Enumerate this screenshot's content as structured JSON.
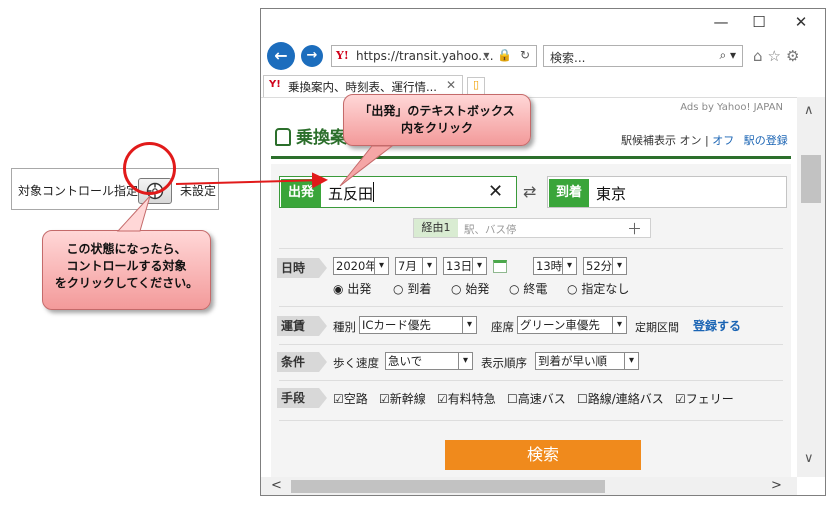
{
  "panel": {
    "label": "対象コントロール指定",
    "status": "未設定"
  },
  "callout_left": {
    "line1": "この状態になったら、",
    "line2": "コントロールする対象",
    "line3": "をクリックしてください。"
  },
  "callout_top": {
    "line1": "「出発」のテキストボックス",
    "line2": "内をクリック"
  },
  "browser": {
    "window_controls": {
      "minimize": "—",
      "maximize": "☐",
      "close": "✕"
    },
    "address": "https://transit.yahoo....",
    "address_tools": "▾ 🔒 ↻",
    "search_placeholder": "検索...",
    "tab_title": "乗換案内、時刻表、運行情...",
    "logo_text": "Y!"
  },
  "page": {
    "ads": "Ads by Yahoo! JAPAN",
    "site_title": "乗換案",
    "header": {
      "station_suggest": "駅候補表示",
      "on": "オン",
      "divider": "|",
      "off": "オフ",
      "register_station": "駅の登録"
    },
    "departure": {
      "label": "出発",
      "value": "五反田"
    },
    "arrival": {
      "label": "到着",
      "value": "東京"
    },
    "via": {
      "label": "経由1",
      "placeholder": "駅、バス停",
      "add": "＋"
    },
    "datetime": {
      "label": "日時",
      "year": "2020年",
      "month": "7月",
      "day": "13日",
      "hour": "13時",
      "minute": "52分",
      "options": [
        "出発",
        "到着",
        "始発",
        "終電",
        "指定なし"
      ],
      "selected": "出発"
    },
    "fare": {
      "label": "運賃",
      "type_label": "種別",
      "type_value": "ICカード優先",
      "seat_label": "座席",
      "seat_value": "グリーン車優先",
      "commuter_label": "定期区間",
      "register_link": "登録する"
    },
    "conditions": {
      "label": "条件",
      "speed_label": "歩く速度",
      "speed_value": "急いで",
      "order_label": "表示順序",
      "order_value": "到着が早い順"
    },
    "means": {
      "label": "手段",
      "items": [
        {
          "name": "空路",
          "checked": true
        },
        {
          "name": "新幹線",
          "checked": true
        },
        {
          "name": "有料特急",
          "checked": true
        },
        {
          "name": "高速バス",
          "checked": false
        },
        {
          "name": "路線/連絡バス",
          "checked": false
        },
        {
          "name": "フェリー",
          "checked": true
        }
      ]
    },
    "search_button": "検索"
  },
  "colors": {
    "green": "#3aa53a",
    "orange": "#f08a1c",
    "link": "#1a64b4",
    "callout": "#f39a9a",
    "highlight_red": "#e11a1a"
  }
}
